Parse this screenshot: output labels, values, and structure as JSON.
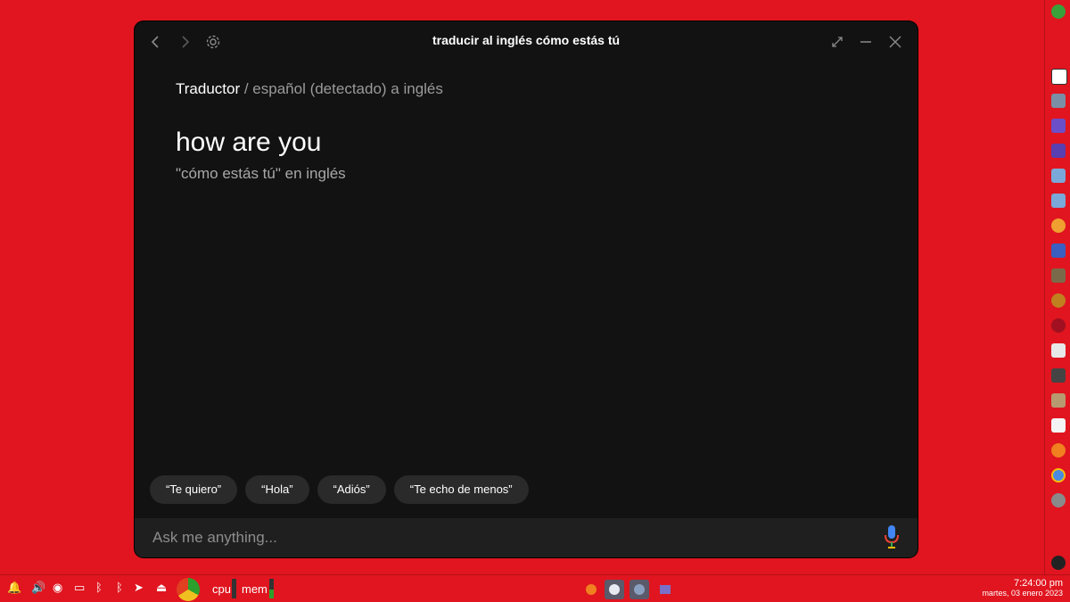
{
  "window": {
    "title": "traducir al inglés cómo estás tú"
  },
  "breadcrumb": {
    "main": "Traductor",
    "rest": " / español (detectado) a inglés"
  },
  "answer": {
    "text": "how are you",
    "subtitle": "\"cómo estás tú\" en inglés"
  },
  "suggestions": [
    "“Te quiero”",
    "“Hola”",
    "“Adiós”",
    "“Te echo de menos”"
  ],
  "input": {
    "placeholder": "Ask me anything..."
  },
  "panel": {
    "cpu_label": "cpu",
    "mem_label": "mem",
    "time": "7:24:00 pm",
    "date": "martes, 03 enero 2023"
  },
  "colors": {
    "desktop": "#e0151f",
    "window_bg": "#121212",
    "chip_bg": "#2a2a2a",
    "input_bg": "#1f1f1f"
  }
}
